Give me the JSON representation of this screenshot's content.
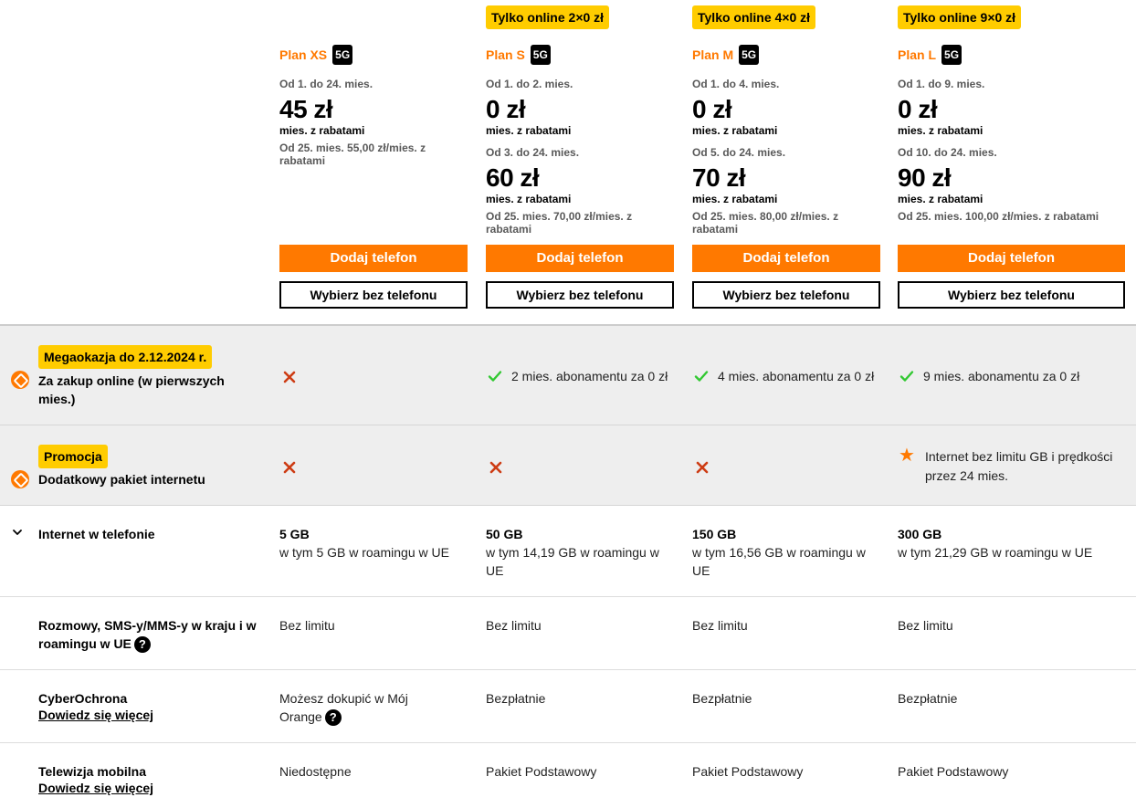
{
  "plans": [
    {
      "name": "Plan XS",
      "badge_5g": "5G",
      "online_badge": "",
      "period1": "Od 1. do 24. mies.",
      "price1": "45 zł",
      "price1_sub": "mies. z rabatami",
      "period2": "",
      "price2": "",
      "price2_sub": "",
      "note": "Od 25. mies. 55,00 zł/mies. z rabatami",
      "add_phone_label": "Dodaj telefon",
      "no_phone_label": "Wybierz bez telefonu"
    },
    {
      "name": "Plan S",
      "badge_5g": "5G",
      "online_badge": "Tylko online 2×0 zł",
      "period1": "Od 1. do 2. mies.",
      "price1": "0 zł",
      "price1_sub": "mies. z rabatami",
      "period2": "Od 3. do 24. mies.",
      "price2": "60 zł",
      "price2_sub": "mies. z rabatami",
      "note": "Od 25. mies. 70,00 zł/mies. z rabatami",
      "add_phone_label": "Dodaj telefon",
      "no_phone_label": "Wybierz bez telefonu"
    },
    {
      "name": "Plan M",
      "badge_5g": "5G",
      "online_badge": "Tylko online 4×0 zł",
      "period1": "Od 1. do 4. mies.",
      "price1": "0 zł",
      "price1_sub": "mies. z rabatami",
      "period2": "Od 5. do 24. mies.",
      "price2": "70 zł",
      "price2_sub": "mies. z rabatami",
      "note": "Od 25. mies. 80,00 zł/mies. z rabatami",
      "add_phone_label": "Dodaj telefon",
      "no_phone_label": "Wybierz bez telefonu"
    },
    {
      "name": "Plan L",
      "badge_5g": "5G",
      "online_badge": "Tylko online 9×0 zł",
      "period1": "Od 1. do 9. mies.",
      "price1": "0 zł",
      "price1_sub": "mies. z rabatami",
      "period2": "Od 10. do 24. mies.",
      "price2": "90 zł",
      "price2_sub": "mies. z rabatami",
      "note": "Od 25. mies. 100,00 zł/mies. z rabatami",
      "add_phone_label": "Dodaj telefon",
      "no_phone_label": "Wybierz bez telefonu"
    }
  ],
  "rows": {
    "megaokazja": {
      "tag": "Megaokazja do 2.12.2024 r.",
      "label": "Za zakup online (w pierwszych mies.)",
      "icon": "promo-tag-icon",
      "values": [
        {
          "status": "no",
          "text": ""
        },
        {
          "status": "yes",
          "text": "2 mies. abonamentu za 0 zł"
        },
        {
          "status": "yes",
          "text": "4 mies. abonamentu za 0 zł"
        },
        {
          "status": "yes",
          "text": "9 mies. abonamentu za 0 zł"
        }
      ]
    },
    "promocja": {
      "tag": "Promocja",
      "label": "Dodatkowy pakiet internetu",
      "icon": "promo-tag-icon",
      "values": [
        {
          "status": "no",
          "text": ""
        },
        {
          "status": "no",
          "text": ""
        },
        {
          "status": "no",
          "text": ""
        },
        {
          "status": "star",
          "text": "Internet bez limitu GB i prędkości przez 24 mies."
        }
      ]
    },
    "internet": {
      "label": "Internet w telefonie",
      "values": [
        {
          "main": "5 GB",
          "sub": "w tym 5 GB w roamingu w UE"
        },
        {
          "main": "50 GB",
          "sub": "w tym 14,19 GB w roamingu w UE"
        },
        {
          "main": "150 GB",
          "sub": "w tym 16,56 GB w roamingu w UE"
        },
        {
          "main": "300 GB",
          "sub": "w tym 21,29 GB w roamingu w UE"
        }
      ]
    },
    "rozmowy": {
      "label": "Rozmowy, SMS-y/MMS-y w kraju i w roamingu w UE",
      "help": "?",
      "values": [
        "Bez limitu",
        "Bez limitu",
        "Bez limitu",
        "Bez limitu"
      ]
    },
    "cyber": {
      "label": "CyberOchrona",
      "link": "Dowiedz się więcej",
      "help": "?",
      "values": [
        "Możesz dokupić w Mój Orange",
        "Bezpłatnie",
        "Bezpłatnie",
        "Bezpłatnie"
      ]
    },
    "tv": {
      "label": "Telewizja mobilna",
      "link": "Dowiedz się więcej",
      "values": [
        "Niedostępne",
        "Pakiet Podstawowy",
        "Pakiet Podstawowy",
        "Pakiet Podstawowy"
      ]
    }
  },
  "colors": {
    "brand_orange": "#ff7900",
    "badge_yellow": "#ffcc00",
    "check_green": "#32c832",
    "cross_red": "#cd3c14",
    "row_gray": "#eeeeee"
  }
}
